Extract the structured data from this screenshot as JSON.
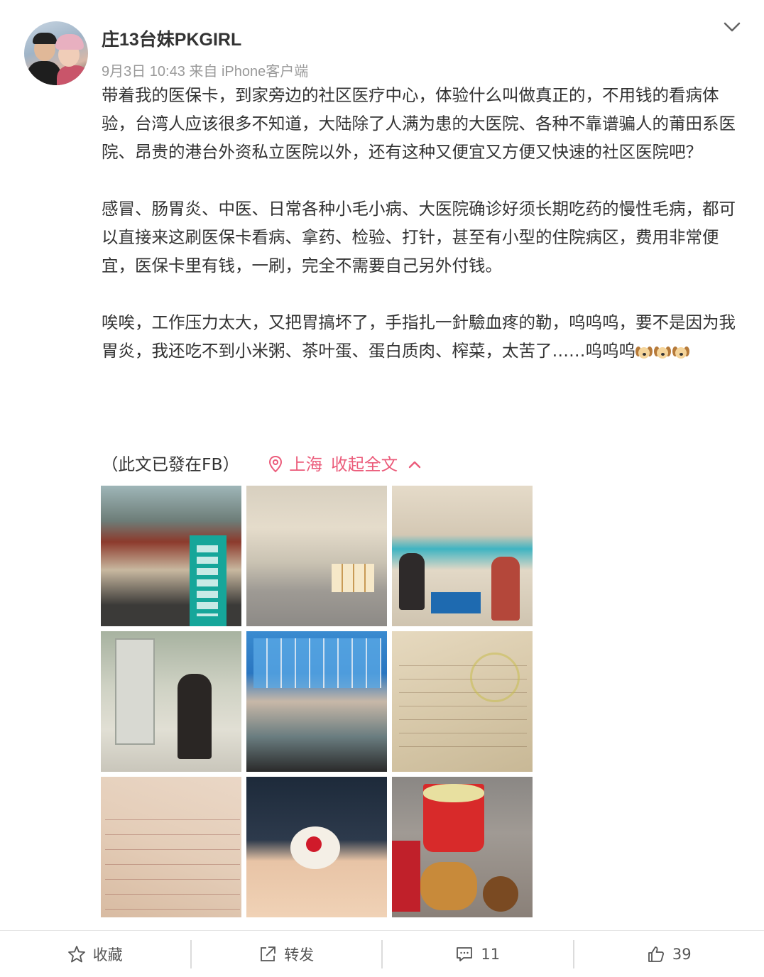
{
  "post": {
    "username": "庄13台妹PKGIRL",
    "meta": "9月3日 10:43 来自 iPhone客户端",
    "paragraphs": [
      "带着我的医保卡，到家旁边的社区医疗中心，体验什么叫做真正的，不用钱的看病体验，台湾人应该很多不知道，大陆除了人满为患的大医院、各种不靠谱骗人的莆田系医院、昂贵的港台外资私立医院以外，还有这种又便宜又方便又快速的社区医院吧？",
      "感冒、肠胃炎、中医、日常各种小毛小病、大医院确诊好须长期吃药的慢性毛病，都可以直接来这刷医保卡看病、拿药、检验、打针，甚至有小型的住院病区，费用非常便宜，医保卡里有钱，一刷，完全不需要自己另外付钱。",
      "唉唉，工作压力太大，又把胃搞坏了，手指扎一針驗血疼的勒，呜呜呜，要不是因为我胃炎，我还吃不到小米粥、茶叶蛋、蛋白质肉、榨菜，太苦了……呜呜呜"
    ],
    "emoji_icons": [
      "dog-face-icon",
      "dog-face-icon",
      "dog-face-icon"
    ],
    "note": "（此文已發在FB）",
    "location": "上海",
    "collapse_label": "收起全文",
    "photos": [
      {
        "icon": "clinic-entrance-photo"
      },
      {
        "icon": "clinic-lobby-photo"
      },
      {
        "icon": "service-counter-photo"
      },
      {
        "icon": "self-service-kiosk-photo"
      },
      {
        "icon": "waiting-area-screen-photo"
      },
      {
        "icon": "receipt-photo"
      },
      {
        "icon": "lab-receipt-photo"
      },
      {
        "icon": "cotton-swab-finger-photo"
      },
      {
        "icon": "breakfast-food-photo"
      }
    ]
  },
  "actions": {
    "favorite_label": "收藏",
    "repost_label": "转发",
    "comment_count": "11",
    "like_count": "39"
  },
  "colors": {
    "accent": "#eb5b7a",
    "meta_text": "#999999",
    "body_text": "#333333"
  }
}
